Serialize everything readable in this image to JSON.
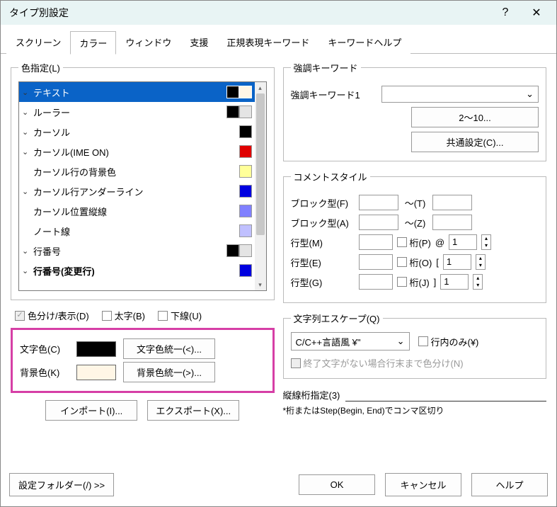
{
  "window": {
    "title": "タイプ別設定",
    "help_icon": "?",
    "close_icon": "✕"
  },
  "tabs": [
    "スクリーン",
    "カラー",
    "ウィンドウ",
    "支援",
    "正規表現キーワード",
    "キーワードヘルプ"
  ],
  "active_tab": 1,
  "color_spec": {
    "legend": "色指定(L)",
    "items": [
      {
        "chev": "⌄",
        "label": "テキスト",
        "fg": "#000000",
        "bg": "#fff6e6",
        "selected": true
      },
      {
        "chev": "⌄",
        "label": "ルーラー",
        "fg": "#000000",
        "bg": "#e4e4e4"
      },
      {
        "chev": "⌄",
        "label": "カーソル",
        "fg": "#000000",
        "bg": ""
      },
      {
        "chev": "⌄",
        "label": "カーソル(IME ON)",
        "fg": "#e00000",
        "bg": ""
      },
      {
        "chev": "",
        "label": "カーソル行の背景色",
        "fg": "",
        "bg": "#ffff99"
      },
      {
        "chev": "⌄",
        "label": "カーソル行アンダーライン",
        "fg": "#0000e0",
        "bg": ""
      },
      {
        "chev": "",
        "label": "カーソル位置縦線",
        "fg": "#8080ff",
        "bg": ""
      },
      {
        "chev": "",
        "label": "ノート線",
        "fg": "#c0c0ff",
        "bg": ""
      },
      {
        "chev": "⌄",
        "label": "行番号",
        "fg": "#000000",
        "bg": "#e4e4e4"
      },
      {
        "chev": "⌄",
        "label": "行番号(変更行)",
        "fg": "#0000e0",
        "bg": "",
        "bold": true
      }
    ]
  },
  "style_checks": {
    "colorize": "色分け/表示(D)",
    "bold": "太字(B)",
    "underline": "下線(U)"
  },
  "color_panel": {
    "fg_label": "文字色(C)",
    "fg_color": "#000000",
    "fg_unify": "文字色統一(<)...",
    "bg_label": "背景色(K)",
    "bg_color": "#fff6e6",
    "bg_unify": "背景色統一(>)..."
  },
  "impexp": {
    "import": "インポート(I)...",
    "export": "エクスポート(X)..."
  },
  "keyword": {
    "legend": "強調キーワード",
    "label1": "強調キーワード1",
    "btn_more": "2〜10...",
    "btn_common": "共通設定(C)..."
  },
  "comment": {
    "legend": "コメントスタイル",
    "block_f": "ブロック型(F)",
    "tilde_t": "〜(T)",
    "block_a": "ブロック型(A)",
    "tilde_z": "〜(Z)",
    "line_m": "行型(M)",
    "col_p": "桁(P)",
    "at": "@",
    "val1": "1",
    "line_e": "行型(E)",
    "col_o": "桁(O)",
    "brL": "[",
    "val2": "1",
    "line_g": "行型(G)",
    "col_j": "桁(J)",
    "brR": "]",
    "val3": "1"
  },
  "escape": {
    "legend": "文字列エスケープ(Q)",
    "select_value": "C/C++言語風 ¥\"",
    "inline_only": "行内のみ(¥)",
    "eol_colorize": "終了文字がない場合行末まで色分け(N)"
  },
  "vline": {
    "label": "縦線桁指定(3)",
    "note": "*桁またはStep(Begin, End)でコンマ区切り"
  },
  "footer": {
    "settings_folder": "設定フォルダー(/) >>",
    "ok": "OK",
    "cancel": "キャンセル",
    "help": "ヘルプ"
  }
}
